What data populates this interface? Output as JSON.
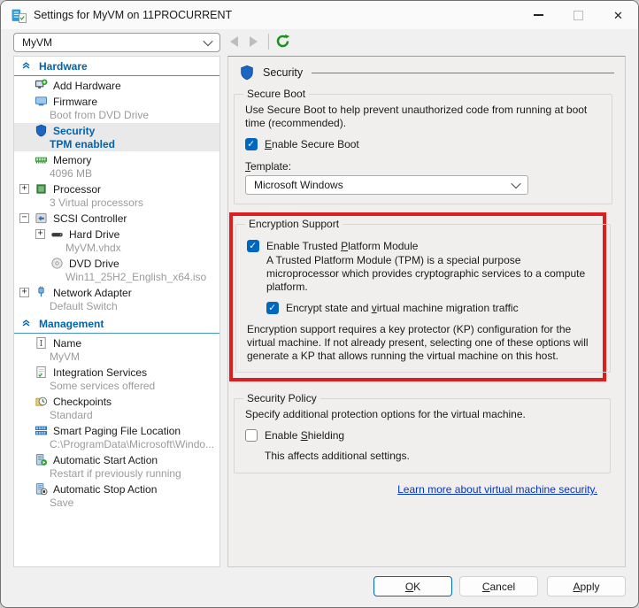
{
  "window": {
    "title": "Settings for MyVM on 11PROCURRENT"
  },
  "toolbar": {
    "vm_selector_value": "MyVM"
  },
  "colors": {
    "accent": "#0067c0",
    "sidebar_blue": "#0063b1",
    "annotation_red": "#dc1e1e",
    "refresh_green": "#149414",
    "link_blue": "#0033cc"
  },
  "icons": {
    "window": "hyperv-settings-icon",
    "refresh": "refresh-icon",
    "back": "back-arrow-icon",
    "forward": "forward-arrow-icon",
    "section_chevron": "chevron-double-up-icon",
    "panel_header": "security-shield-icon"
  },
  "sidebar": {
    "sections": [
      {
        "id": "hardware",
        "label": "Hardware",
        "items": [
          {
            "icon": "add-hardware-icon",
            "label": "Add Hardware"
          },
          {
            "icon": "firmware-icon",
            "label": "Firmware",
            "sub": "Boot from DVD Drive"
          },
          {
            "icon": "security-shield-icon",
            "label": "Security",
            "sub": "TPM enabled",
            "selected": true
          },
          {
            "icon": "memory-icon",
            "label": "Memory",
            "sub": "4096 MB"
          },
          {
            "icon": "processor-icon",
            "label": "Processor",
            "sub": "3 Virtual processors",
            "expander": "expand"
          },
          {
            "icon": "scsi-controller-icon",
            "label": "SCSI Controller",
            "expander": "collapse"
          },
          {
            "icon": "hard-drive-icon",
            "label": "Hard Drive",
            "sub": "MyVM.vhdx",
            "expander": "expand",
            "indent": 1
          },
          {
            "icon": "dvd-drive-icon",
            "label": "DVD Drive",
            "sub": "Win11_25H2_English_x64.iso",
            "indent": 1
          },
          {
            "icon": "network-adapter-icon",
            "label": "Network Adapter",
            "sub": "Default Switch",
            "expander": "expand"
          }
        ]
      },
      {
        "id": "management",
        "label": "Management",
        "items": [
          {
            "icon": "name-icon",
            "label": "Name",
            "sub": "MyVM"
          },
          {
            "icon": "integration-services-icon",
            "label": "Integration Services",
            "sub": "Some services offered"
          },
          {
            "icon": "checkpoints-icon",
            "label": "Checkpoints",
            "sub": "Standard"
          },
          {
            "icon": "smart-paging-icon",
            "label": "Smart Paging File Location",
            "sub": "C:\\ProgramData\\Microsoft\\Windo..."
          },
          {
            "icon": "auto-start-icon",
            "label": "Automatic Start Action",
            "sub": "Restart if previously running"
          },
          {
            "icon": "auto-stop-icon",
            "label": "Automatic Stop Action",
            "sub": "Save"
          }
        ]
      }
    ]
  },
  "panel": {
    "header": "Security",
    "secure_boot": {
      "legend": "Secure Boot",
      "desc": "Use Secure Boot to help prevent unauthorized code from running at boot time (recommended).",
      "enable_label": {
        "pre": "",
        "key": "E",
        "post": "nable Secure Boot"
      },
      "template_label": {
        "pre": "",
        "key": "T",
        "post": "emplate:"
      },
      "template_value": "Microsoft Windows"
    },
    "encryption": {
      "legend": "Encryption Support",
      "tpm_label": {
        "pre": "Enable Trusted ",
        "key": "P",
        "post": "latform Module"
      },
      "tpm_desc": "A Trusted Platform Module (TPM) is a special purpose microprocessor which provides cryptographic services to a compute platform.",
      "encrypt_label": {
        "pre": "Encrypt state and ",
        "key": "v",
        "post": "irtual machine migration traffic"
      },
      "kp_desc": "Encryption support requires a key protector (KP) configuration for the virtual machine. If not already present, selecting one of these options will generate a KP that allows running the virtual machine on this host."
    },
    "security_policy": {
      "legend": "Security Policy",
      "desc": "Specify additional protection options for the virtual machine.",
      "shielding_label": {
        "pre": "Enable ",
        "key": "S",
        "post": "hielding"
      },
      "note": "This affects additional settings."
    },
    "link": "Learn more about virtual machine security."
  },
  "buttons": {
    "ok": {
      "pre": "",
      "key": "O",
      "post": "K"
    },
    "cancel": {
      "pre": "",
      "key": "C",
      "post": "ancel"
    },
    "apply": {
      "pre": "",
      "key": "A",
      "post": "pply"
    }
  }
}
